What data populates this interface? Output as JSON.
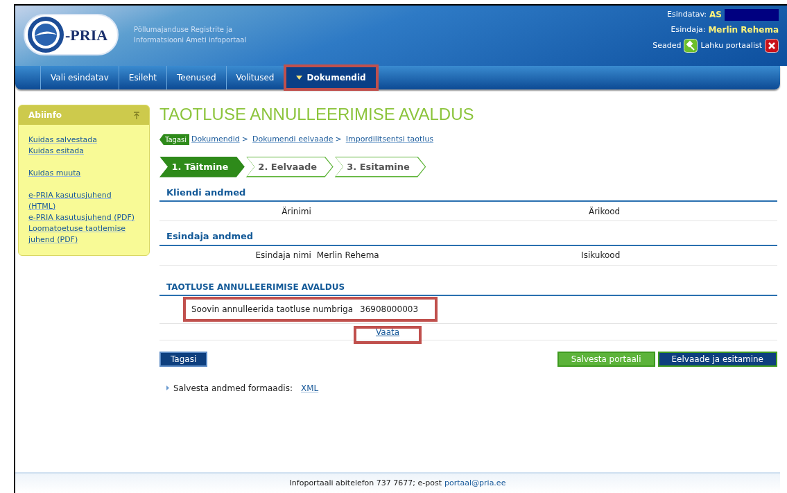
{
  "header": {
    "logo_text": "-PRIA",
    "subtitle": [
      "Põllumajanduse Registrite ja",
      "Informatsiooni Ameti infoportaal"
    ],
    "represented_label": "Esindatav:",
    "represented_value": "AS",
    "representative_label": "Esindaja:",
    "representative_value": "Merlin Rehema",
    "settings": "Seaded",
    "logout": "Lahku portaalist"
  },
  "nav": [
    {
      "label": "Vali esindatav",
      "selected": false,
      "highlighted": false,
      "dropdown": false
    },
    {
      "label": "Esileht",
      "selected": false,
      "highlighted": false,
      "dropdown": false
    },
    {
      "label": "Teenused",
      "selected": false,
      "highlighted": false,
      "dropdown": false
    },
    {
      "label": "Volitused",
      "selected": false,
      "highlighted": false,
      "dropdown": false
    },
    {
      "label": "Dokumendid",
      "selected": true,
      "highlighted": true,
      "dropdown": true
    }
  ],
  "sidebar": {
    "title": "Abiinfo",
    "groups": [
      [
        "Kuidas salvestada",
        "Kuidas esitada"
      ],
      [
        "Kuidas muuta"
      ],
      [
        "e-PRIA kasutusjuhend (HTML)",
        "e-PRIA kasutusjuhend (PDF)",
        "Loomatoetuse taotlemise juhend (PDF)"
      ]
    ]
  },
  "page_title": "TAOTLUSE ANNULLEERIMISE AVALDUS",
  "breadcrumb": {
    "back": "Tagasi",
    "items": [
      {
        "label": "Dokumendid",
        "separator": ">"
      },
      {
        "label": "Dokumendi eelvaade",
        "separator": ">"
      },
      {
        "label": "Impordilitsentsi taotlus"
      }
    ]
  },
  "steps": [
    {
      "label": "1. Täitmine",
      "selected": true
    },
    {
      "label": "2. Eelvaade",
      "selected": false
    },
    {
      "label": "3. Esitamine",
      "selected": false
    }
  ],
  "sections": [
    {
      "title": "Kliendi andmed",
      "fields": [
        {
          "label": "Ärinimi"
        },
        {
          "label": "Ärikood"
        }
      ]
    },
    {
      "title": "Esindaja andmed",
      "fields": [
        {
          "label": "Esindaja nimi",
          "value": "Merlin Rehema"
        },
        {
          "label": "Isikukood"
        }
      ]
    }
  ],
  "application": {
    "title": "TAOTLUSE ANNULLEERIMISE AVALDUS",
    "request_label": "Soovin annulleerida taotluse numbriga",
    "number": "36908000003",
    "highlighted": true,
    "link": "Vaata",
    "link_highlighted": true
  },
  "buttons": {
    "back": "Tagasi",
    "save": "Salvesta portaali",
    "preview": "Eelvaade ja esitamine"
  },
  "export": {
    "label": "Salvesta andmed formaadis:",
    "link": "XML"
  },
  "footer": {
    "text": "Infoportaali abitelefon 737 7677; e-post",
    "email": "portaal@pria.ee"
  }
}
